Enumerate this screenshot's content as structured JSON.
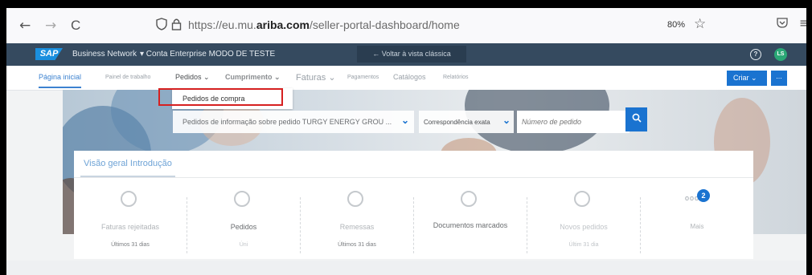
{
  "browser": {
    "back": "←",
    "forward": "→",
    "reload": "C",
    "shield": "◯",
    "lock": "🔒",
    "url_prefix": "https://eu.mu.",
    "url_domain": "ariba.com",
    "url_path": "/seller-portal-dashboard/home",
    "zoom": "80%",
    "star": "☆",
    "pocket": "♡",
    "menu": "≡"
  },
  "sap_header": {
    "logo": "SAP",
    "business_network": "Business Network",
    "account": "▾ Conta Enterprise MODO DE TESTE",
    "classic_view": "← Voltar à vista clássica",
    "help": "?",
    "avatar_initials": "LS"
  },
  "nav": {
    "items": [
      {
        "label": "Página inicial"
      },
      {
        "label": "Painel de trabalho"
      },
      {
        "label": "Pedidos ⌄"
      },
      {
        "label": "Cumprimento ⌄"
      },
      {
        "label": "Faturas ⌄"
      },
      {
        "label": "Pagamentos"
      },
      {
        "label": "Catálogos"
      },
      {
        "label": "Relatórios"
      }
    ],
    "criar": "Criar ⌄",
    "more": "..."
  },
  "dropdown": {
    "item": "Pedidos de compra"
  },
  "search": {
    "type_select": "Pedidos de informação sobre pedido TURGY ENERGY GROU ...",
    "match_select": "Correspondência exata",
    "chevron": "⌄",
    "placeholder": "Número de pedido",
    "search_icon": "🔍"
  },
  "overview": {
    "title": "Visão geral Introdução",
    "tiles": [
      {
        "label": "Faturas rejeitadas",
        "sub": "Últimos 31 dias"
      },
      {
        "label": "Pedidos",
        "sub": "Úni"
      },
      {
        "label": "Remessas",
        "sub": "Últimos 31 dias"
      },
      {
        "label": "Documentos marcados",
        "sub": ""
      },
      {
        "label": "Novos pedidos",
        "sub": "Últim 31 dia"
      },
      {
        "label": "Mais",
        "sub": ""
      }
    ],
    "mais_badge": "2",
    "mais_dots": "ooo"
  }
}
